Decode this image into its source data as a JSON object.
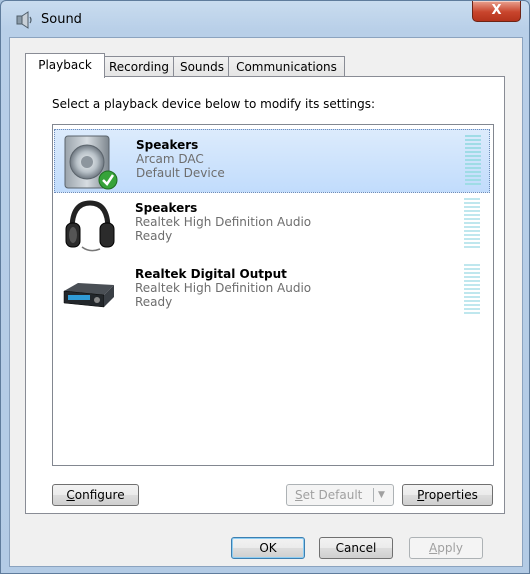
{
  "window": {
    "title": "Sound",
    "close_label": "X"
  },
  "tabs": [
    {
      "label": "Playback"
    },
    {
      "label": "Recording"
    },
    {
      "label": "Sounds"
    },
    {
      "label": "Communications"
    }
  ],
  "instruction": "Select a playback device below to modify its settings:",
  "devices": [
    {
      "name": "Speakers",
      "sub1": "Arcam DAC",
      "sub2": "Default Device",
      "icon": "speaker-icon",
      "selected": true,
      "status": "default-check-icon"
    },
    {
      "name": "Speakers",
      "sub1": "Realtek High Definition Audio",
      "sub2": "Ready",
      "icon": "headphones-icon"
    },
    {
      "name": "Realtek Digital Output",
      "sub1": "Realtek High Definition Audio",
      "sub2": "Ready",
      "icon": "digital-receiver-icon"
    }
  ],
  "buttons": {
    "configure": {
      "mnemonic": "C",
      "rest": "onfigure"
    },
    "set_default": {
      "mnemonic": "S",
      "rest": "et Default"
    },
    "properties": {
      "mnemonic": "P",
      "rest": "roperties"
    },
    "ok": "OK",
    "cancel": "Cancel",
    "apply": {
      "mnemonic": "A",
      "rest": "pply"
    }
  },
  "colors": {
    "accent": "#3399ff",
    "selection": "#c1dcfc",
    "close": "#c8452d",
    "meter": "#9fdce6"
  }
}
